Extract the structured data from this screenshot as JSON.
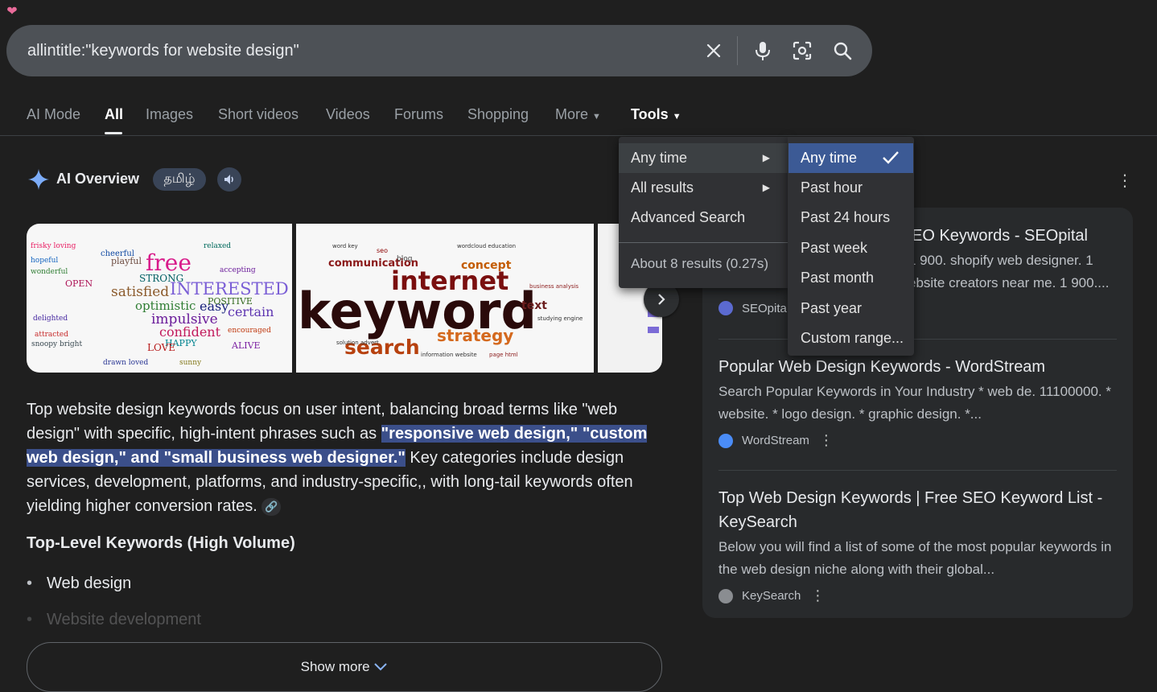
{
  "search": {
    "query": "allintitle:\"keywords for website design\"",
    "icons": [
      "close-icon",
      "microphone-icon",
      "lens-camera-icon",
      "search-icon"
    ]
  },
  "tabs": [
    {
      "label": "AI Mode"
    },
    {
      "label": "All"
    },
    {
      "label": "Images"
    },
    {
      "label": "Short videos"
    },
    {
      "label": "Videos"
    },
    {
      "label": "Forums"
    },
    {
      "label": "Shopping"
    },
    {
      "label": "More"
    },
    {
      "label": "Tools"
    }
  ],
  "ai_overview": {
    "title": "AI Overview",
    "language_chip": "தமிழ்",
    "paragraph": {
      "part1": "Top website design keywords focus on user intent, balancing broad terms like \"web design\" with specific, high-intent phrases such as ",
      "highlight": "\"responsive web design,\" \"custom web design,\" and \"small business web designer.\"",
      "part2": " Key categories include design services, development, platforms, and industry-specific,, with long-tail keywords often yielding higher conversion rates. "
    },
    "heading": "Top-Level Keywords (High Volume)",
    "bullets": [
      "Web design",
      "Website development"
    ],
    "show_more": "Show more",
    "images": {
      "img1_words": [
        "free",
        "INTERESTED",
        "satisfied",
        "optimistic",
        "easy",
        "certain",
        "impulsive",
        "confident",
        "POSITIVE",
        "HAPPY",
        "LOVE",
        "STRONG",
        "OPEN",
        "playful",
        "cheerful",
        "ALIVE"
      ],
      "img2_words": [
        "internet",
        "keyword",
        "search",
        "strategy",
        "communication",
        "concept",
        "text",
        "blog",
        "seo"
      ]
    }
  },
  "tools_menu": {
    "items": [
      {
        "label": "Any time",
        "has_arrow": true
      },
      {
        "label": "All results",
        "has_arrow": true
      },
      {
        "label": "Advanced Search",
        "has_arrow": false
      }
    ],
    "stats": "About 8 results (0.27s)"
  },
  "time_submenu": {
    "items": [
      "Any time",
      "Past hour",
      "Past 24 hours",
      "Past week",
      "Past month",
      "Past year",
      "Custom range..."
    ],
    "selected": "Any time"
  },
  "results": [
    {
      "title": "EO Keywords - SEOpital",
      "snippet_lines": [
        "1 900. shopify web designer. 1",
        "ebsite creators near me. 1 900...."
      ],
      "source": "SEOpita",
      "favicon_color": "#5b6ad0"
    },
    {
      "title": "Popular Web Design Keywords - WordStream",
      "snippet": "Search Popular Keywords in Your Industry * web de. 11100000. * website. * logo design. * graphic design. *...",
      "source": "WordStream",
      "favicon_color": "#4a8cf7"
    },
    {
      "title": "Top Web Design Keywords | Free SEO Keyword List - KeySearch",
      "snippet": "Below you will find a list of some of the most popular keywords in the web design niche along with their global...",
      "source": "KeySearch",
      "favicon_color": "#8a8d91"
    }
  ],
  "colors": {
    "background": "#1f1f1f",
    "search_bar": "#4d5156",
    "highlight": "#3b4f8a",
    "selected_menu": "#3c5a95"
  }
}
